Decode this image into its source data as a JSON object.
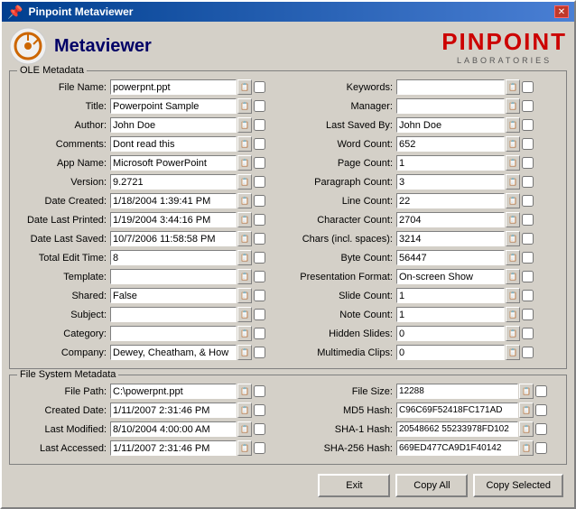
{
  "window": {
    "title": "Pinpoint Metaviewer",
    "close_label": "✕"
  },
  "header": {
    "title": "Metaviewer",
    "logo_main": "PINPOINT",
    "logo_sub": "LABORATORIES"
  },
  "ole_group": {
    "title": "OLE Metadata",
    "left_fields": [
      {
        "label": "File Name:",
        "value": "powerpnt.ppt"
      },
      {
        "label": "Title:",
        "value": "Powerpoint Sample"
      },
      {
        "label": "Author:",
        "value": "John Doe"
      },
      {
        "label": "Comments:",
        "value": "Dont read this"
      },
      {
        "label": "App Name:",
        "value": "Microsoft PowerPoint"
      },
      {
        "label": "Version:",
        "value": "9.2721"
      },
      {
        "label": "Date Created:",
        "value": "1/18/2004 1:39:41 PM"
      },
      {
        "label": "Date Last Printed:",
        "value": "1/19/2004 3:44:16 PM"
      },
      {
        "label": "Date Last Saved:",
        "value": "10/7/2006 11:58:58 PM"
      },
      {
        "label": "Total Edit Time:",
        "value": "8"
      },
      {
        "label": "Template:",
        "value": ""
      },
      {
        "label": "Shared:",
        "value": "False"
      },
      {
        "label": "Subject:",
        "value": ""
      },
      {
        "label": "Category:",
        "value": ""
      },
      {
        "label": "Company:",
        "value": "Dewey, Cheatham, & How"
      }
    ],
    "right_fields": [
      {
        "label": "Keywords:",
        "value": ""
      },
      {
        "label": "Manager:",
        "value": ""
      },
      {
        "label": "Last Saved By:",
        "value": "John Doe"
      },
      {
        "label": "Word Count:",
        "value": "652"
      },
      {
        "label": "Page Count:",
        "value": "1"
      },
      {
        "label": "Paragraph Count:",
        "value": "3"
      },
      {
        "label": "Line Count:",
        "value": "22"
      },
      {
        "label": "Character Count:",
        "value": "2704"
      },
      {
        "label": "Chars (incl. spaces):",
        "value": "3214"
      },
      {
        "label": "Byte Count:",
        "value": "56447"
      },
      {
        "label": "Presentation Format:",
        "value": "On-screen Show"
      },
      {
        "label": "Slide Count:",
        "value": "1"
      },
      {
        "label": "Note Count:",
        "value": "1"
      },
      {
        "label": "Hidden Slides:",
        "value": "0"
      },
      {
        "label": "Multimedia Clips:",
        "value": "0"
      }
    ]
  },
  "fs_group": {
    "title": "File System Metadata",
    "left_fields": [
      {
        "label": "File Path:",
        "value": "C:\\powerpnt.ppt"
      },
      {
        "label": "Created Date:",
        "value": "1/11/2007 2:31:46 PM"
      },
      {
        "label": "Last Modified:",
        "value": "8/10/2004 4:00:00 AM"
      },
      {
        "label": "Last Accessed:",
        "value": "1/11/2007 2:31:46 PM"
      }
    ],
    "right_fields": [
      {
        "label": "File Size:",
        "value": "12288"
      },
      {
        "label": "MD5 Hash:",
        "value": "C96C69F52418FC171AD"
      },
      {
        "label": "SHA-1 Hash:",
        "value": "20548662 55233978FD102"
      },
      {
        "label": "SHA-256 Hash:",
        "value": "669ED477CA9D1F40142"
      }
    ]
  },
  "buttons": {
    "exit": "Exit",
    "copy_all": "Copy All",
    "copy_selected": "Copy Selected"
  }
}
